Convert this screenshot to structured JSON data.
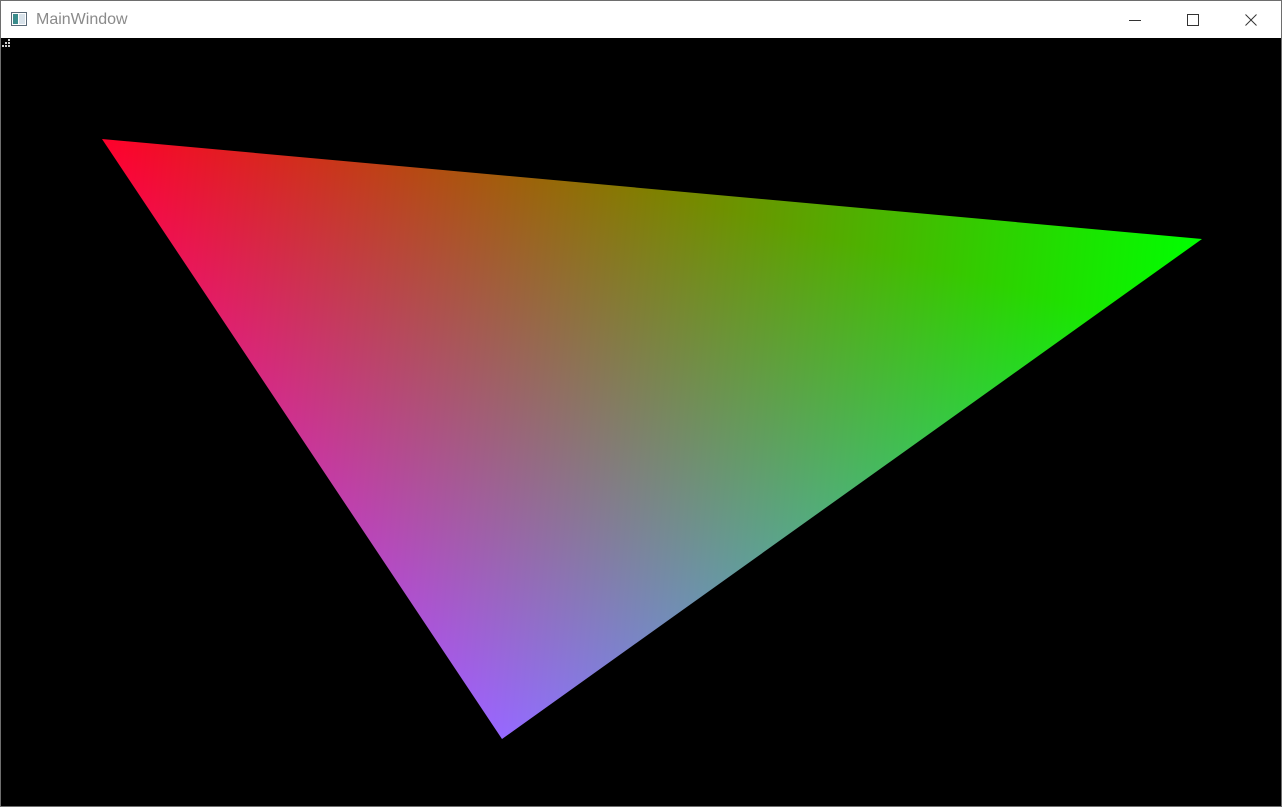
{
  "window": {
    "title": "MainWindow",
    "icon": "app-window-icon",
    "controls": {
      "minimize_icon": "minimize-icon",
      "maximize_icon": "maximize-icon",
      "close_icon": "close-icon"
    }
  },
  "canvas": {
    "background": "#000000",
    "triangle": {
      "vertex_colors": {
        "top_left": "#ff0000",
        "right": "#00ff00",
        "bottom": "#0000ff"
      }
    }
  }
}
